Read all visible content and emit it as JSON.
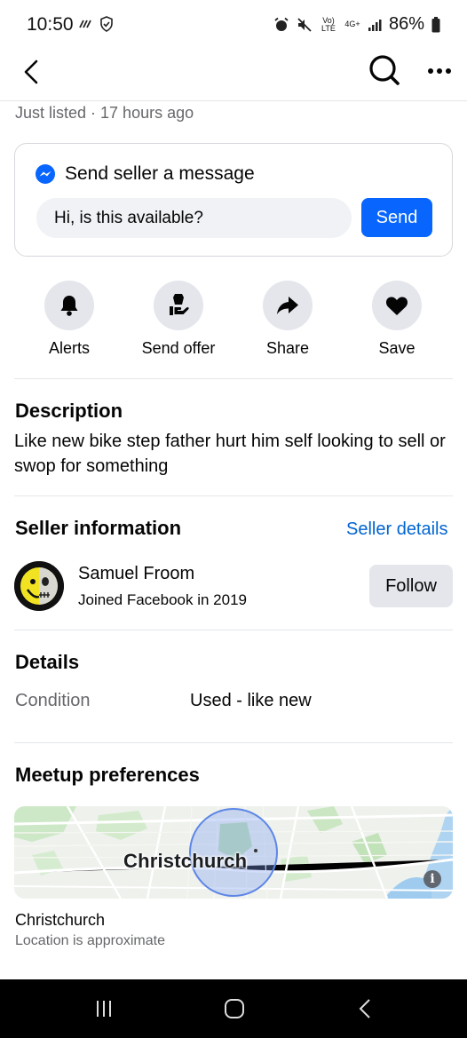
{
  "status_bar": {
    "time": "10:50",
    "network_lte": "Vo) LTE",
    "network_4g": "4G+",
    "battery": "86%"
  },
  "header": {
    "back_icon": "chevron-left-icon",
    "search_icon": "search-icon",
    "more_icon": "more-horizontal-icon"
  },
  "listing": {
    "listed_time": "Just listed · 17 hours ago"
  },
  "message": {
    "title": "Send seller a message",
    "input_value": "Hi, is this available?",
    "send_label": "Send",
    "accent": "#0866ff"
  },
  "actions": [
    {
      "label": "Alerts",
      "icon": "bell-icon"
    },
    {
      "label": "Send offer",
      "icon": "offer-hand-icon"
    },
    {
      "label": "Share",
      "icon": "share-arrow-icon"
    },
    {
      "label": "Save",
      "icon": "heart-icon"
    }
  ],
  "description": {
    "title": "Description",
    "text": "Like new bike step father hurt him self looking to sell or swop for something"
  },
  "seller": {
    "title": "Seller information",
    "details_link": "Seller details",
    "name": "Samuel Froom",
    "joined": "Joined Facebook in 2019",
    "follow_label": "Follow"
  },
  "details": {
    "title": "Details",
    "condition_label": "Condition",
    "condition_value": "Used - like new"
  },
  "meetup": {
    "title": "Meetup preferences",
    "map_label": "Christchurch",
    "location_name": "Christchurch",
    "location_note": "Location is approximate"
  },
  "nav": {
    "recents_icon": "recents-icon",
    "home_icon": "home-icon",
    "back_icon": "nav-back-icon"
  }
}
